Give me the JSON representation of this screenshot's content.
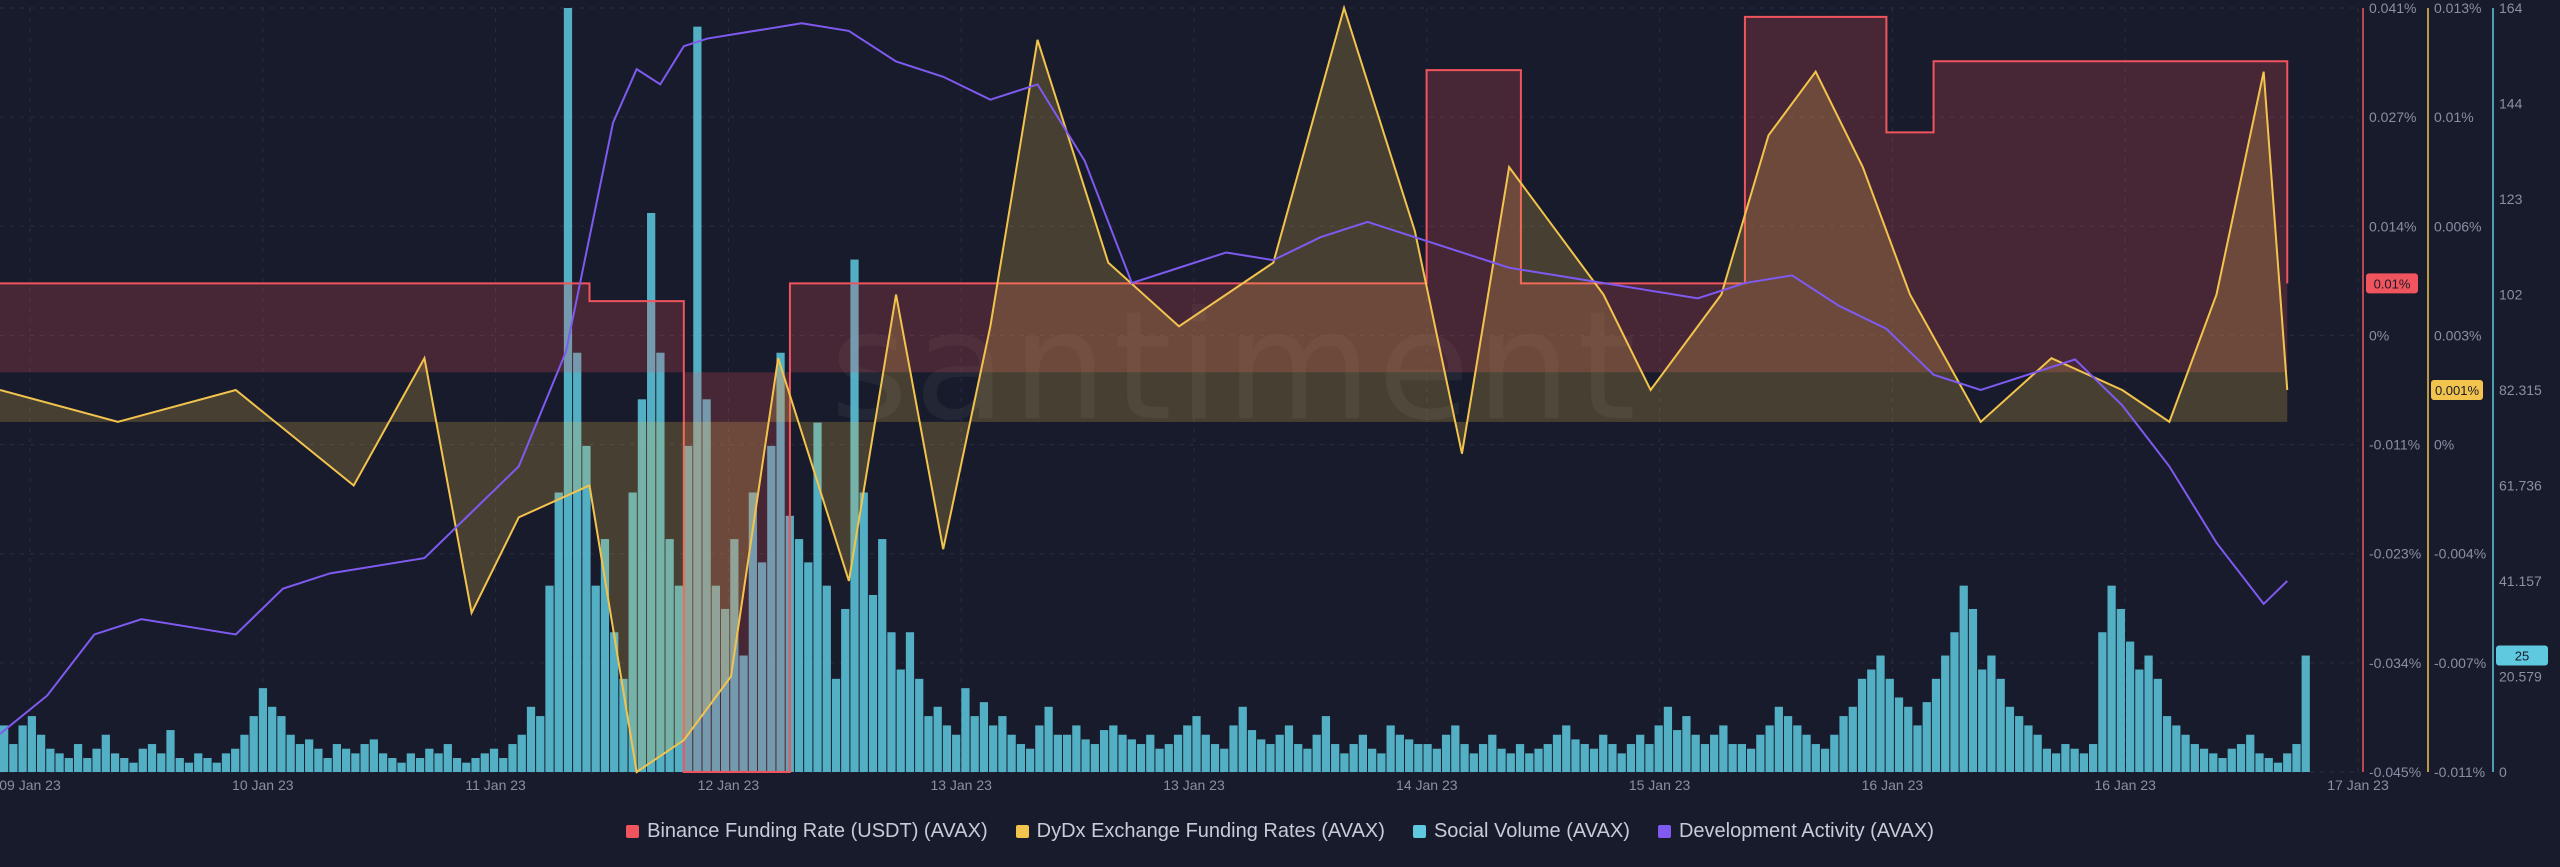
{
  "watermark": "santiment",
  "chart_data": {
    "type": "line",
    "x_range": [
      "09 Jan 23",
      "17 Jan 23"
    ],
    "x_ticks": [
      "09 Jan 23",
      "10 Jan 23",
      "11 Jan 23",
      "12 Jan 23",
      "13 Jan 23",
      "13 Jan 23",
      "14 Jan 23",
      "15 Jan 23",
      "16 Jan 23",
      "16 Jan 23",
      "17 Jan 23"
    ],
    "axes": {
      "binance": {
        "ticks": [
          "0.041%",
          "0.027%",
          "0.014%",
          "0%",
          "-0.011%",
          "-0.023%",
          "-0.034%",
          "-0.045%"
        ],
        "min": -0.045,
        "max": 0.041,
        "unit": "%",
        "current_label": "0.01%",
        "color": "#f0545c"
      },
      "dydx": {
        "ticks": [
          "0.013%",
          "0.01%",
          "0.006%",
          "0.003%",
          "0%",
          "-0.004%",
          "-0.007%",
          "-0.011%"
        ],
        "min": -0.011,
        "max": 0.013,
        "unit": "%",
        "current_label": "0.001%",
        "color": "#f3c44d"
      },
      "social": {
        "ticks": [
          "164",
          "144",
          "123",
          "102",
          "82.315",
          "61.736",
          "41.157",
          "20.579",
          "0"
        ],
        "min": 0,
        "max": 164,
        "current_label": "25",
        "color": "#5ec9df"
      },
      "dev": {
        "min": 0,
        "max": 100,
        "color": "#7f5af0"
      }
    },
    "series": [
      {
        "name": "Binance Funding Rate (USDT) (AVAX)",
        "key": "binance",
        "color": "#f0545c",
        "x": [
          0,
          0.2,
          0.25,
          0.28,
          0.29,
          0.33,
          0.335,
          0.45,
          0.5,
          0.6,
          0.605,
          0.64,
          0.645,
          0.73,
          0.74,
          0.76,
          0.8,
          0.82,
          0.86,
          0.97
        ],
        "values": [
          0.01,
          0.01,
          0.008,
          0.008,
          -0.045,
          -0.045,
          0.01,
          0.01,
          0.01,
          0.01,
          0.034,
          0.034,
          0.01,
          0.01,
          0.04,
          0.04,
          0.027,
          0.035,
          0.035,
          0.01
        ]
      },
      {
        "name": "DyDx Exchange Funding Rates (AVAX)",
        "key": "dydx",
        "color": "#f3c44d",
        "x": [
          0,
          0.05,
          0.1,
          0.15,
          0.18,
          0.2,
          0.22,
          0.25,
          0.27,
          0.29,
          0.31,
          0.33,
          0.36,
          0.38,
          0.4,
          0.42,
          0.44,
          0.47,
          0.5,
          0.54,
          0.57,
          0.6,
          0.62,
          0.64,
          0.66,
          0.68,
          0.7,
          0.73,
          0.75,
          0.77,
          0.79,
          0.81,
          0.84,
          0.87,
          0.9,
          0.92,
          0.94,
          0.96,
          0.97
        ],
        "values": [
          0.001,
          0.0,
          0.001,
          -0.002,
          0.002,
          -0.006,
          -0.003,
          -0.002,
          -0.011,
          -0.01,
          -0.008,
          0.002,
          -0.005,
          0.004,
          -0.004,
          0.003,
          0.012,
          0.005,
          0.003,
          0.005,
          0.013,
          0.006,
          -0.001,
          0.008,
          0.006,
          0.004,
          0.001,
          0.004,
          0.009,
          0.011,
          0.008,
          0.004,
          0.0,
          0.002,
          0.001,
          0.0,
          0.004,
          0.011,
          0.001
        ]
      },
      {
        "name": "Social Volume (AVAX)",
        "key": "social",
        "color": "#5ec9df",
        "type": "bar",
        "x_start": 0,
        "x_end": 0.98,
        "count": 280,
        "values": [
          10,
          6,
          10,
          12,
          8,
          5,
          4,
          3,
          6,
          3,
          5,
          8,
          4,
          3,
          2,
          5,
          6,
          4,
          9,
          3,
          2,
          4,
          3,
          2,
          4,
          5,
          8,
          12,
          18,
          14,
          12,
          8,
          6,
          7,
          5,
          3,
          6,
          5,
          4,
          6,
          7,
          4,
          3,
          2,
          4,
          3,
          5,
          4,
          6,
          3,
          2,
          3,
          4,
          5,
          3,
          6,
          8,
          14,
          12,
          40,
          60,
          164,
          90,
          70,
          40,
          50,
          30,
          20,
          60,
          80,
          120,
          90,
          50,
          40,
          70,
          160,
          80,
          40,
          35,
          50,
          25,
          60,
          45,
          70,
          90,
          55,
          50,
          45,
          75,
          40,
          20,
          35,
          110,
          60,
          38,
          50,
          30,
          22,
          30,
          20,
          12,
          14,
          10,
          8,
          18,
          12,
          15,
          10,
          12,
          8,
          6,
          5,
          10,
          14,
          8,
          8,
          10,
          7,
          6,
          9,
          10,
          8,
          7,
          6,
          8,
          5,
          6,
          8,
          10,
          12,
          8,
          6,
          5,
          10,
          14,
          9,
          7,
          6,
          8,
          10,
          6,
          5,
          8,
          12,
          6,
          4,
          6,
          8,
          5,
          4,
          10,
          8,
          7,
          6,
          6,
          5,
          8,
          10,
          6,
          4,
          6,
          8,
          5,
          4,
          6,
          4,
          5,
          6,
          8,
          10,
          7,
          6,
          5,
          8,
          6,
          4,
          6,
          8,
          6,
          10,
          14,
          9,
          12,
          8,
          6,
          8,
          10,
          6,
          6,
          5,
          8,
          10,
          14,
          12,
          10,
          8,
          6,
          5,
          8,
          12,
          14,
          20,
          22,
          25,
          20,
          16,
          14,
          10,
          15,
          20,
          25,
          30,
          40,
          35,
          22,
          25,
          20,
          14,
          12,
          10,
          8,
          5,
          4,
          6,
          5,
          4,
          6,
          30,
          40,
          35,
          28,
          22,
          25,
          20,
          12,
          10,
          8,
          6,
          5,
          4,
          3,
          5,
          6,
          8,
          4,
          3,
          2,
          4,
          6,
          25
        ]
      },
      {
        "name": "Development Activity (AVAX)",
        "key": "dev",
        "color": "#7f5af0",
        "x": [
          0,
          0.02,
          0.04,
          0.06,
          0.1,
          0.12,
          0.14,
          0.18,
          0.2,
          0.22,
          0.24,
          0.25,
          0.26,
          0.27,
          0.28,
          0.29,
          0.3,
          0.32,
          0.34,
          0.36,
          0.38,
          0.4,
          0.42,
          0.44,
          0.46,
          0.48,
          0.5,
          0.52,
          0.54,
          0.56,
          0.58,
          0.6,
          0.62,
          0.64,
          0.66,
          0.68,
          0.7,
          0.72,
          0.74,
          0.76,
          0.78,
          0.8,
          0.82,
          0.84,
          0.86,
          0.88,
          0.9,
          0.92,
          0.94,
          0.96,
          0.97
        ],
        "values": [
          5,
          10,
          18,
          20,
          18,
          24,
          26,
          28,
          34,
          40,
          55,
          70,
          85,
          92,
          90,
          95,
          96,
          97,
          98,
          97,
          93,
          91,
          88,
          90,
          80,
          64,
          66,
          68,
          67,
          70,
          72,
          70,
          68,
          66,
          65,
          64,
          63,
          62,
          64,
          65,
          61,
          58,
          52,
          50,
          52,
          54,
          48,
          40,
          30,
          22,
          25
        ]
      }
    ],
    "legend_position": "bottom",
    "grid": true
  }
}
